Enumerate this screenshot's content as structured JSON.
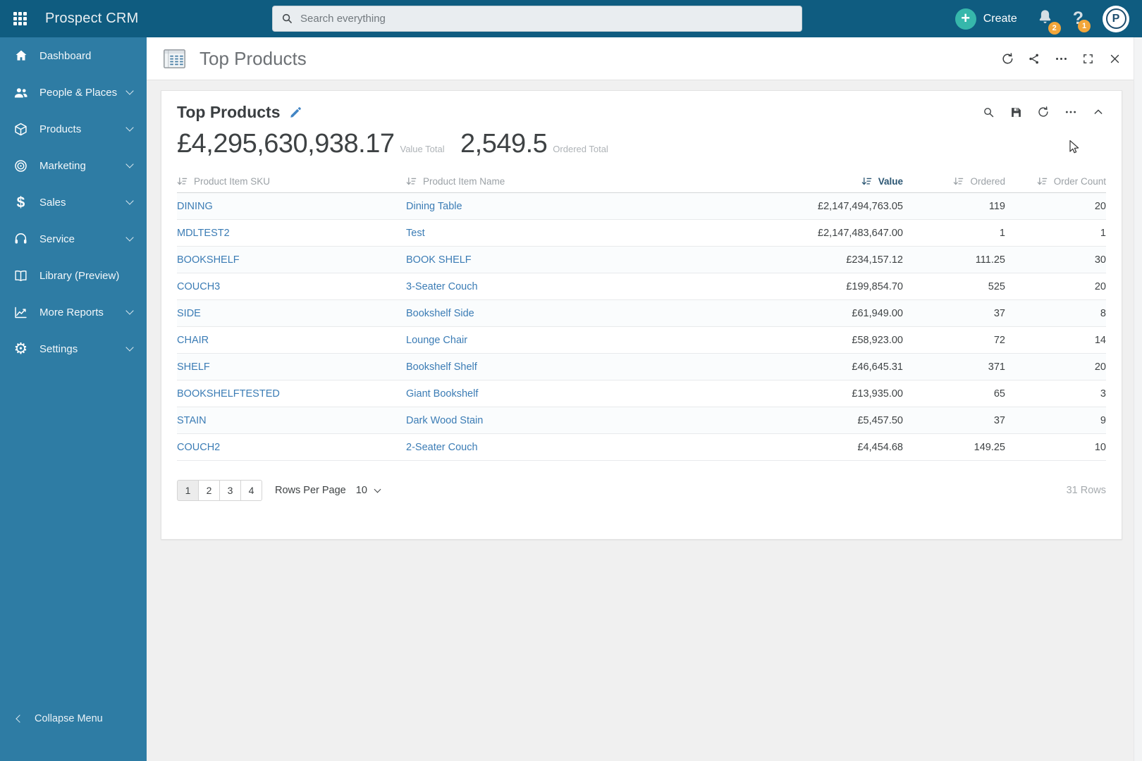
{
  "topbar": {
    "app_name": "Prospect CRM",
    "search": {
      "placeholder": "Search everything"
    },
    "create_label": "Create",
    "notifications_badge": "2",
    "help_badge": "1",
    "avatar_letter": "P"
  },
  "sidebar": {
    "items": [
      {
        "label": "Dashboard",
        "icon": "home",
        "chevron": false
      },
      {
        "label": "People & Places",
        "icon": "people",
        "chevron": true
      },
      {
        "label": "Products",
        "icon": "cube",
        "chevron": true
      },
      {
        "label": "Marketing",
        "icon": "target",
        "chevron": true
      },
      {
        "label": "Sales",
        "icon": "dollar",
        "chevron": true
      },
      {
        "label": "Service",
        "icon": "headset",
        "chevron": true
      },
      {
        "label": "Library (Preview)",
        "icon": "book",
        "chevron": false
      },
      {
        "label": "More Reports",
        "icon": "chart",
        "chevron": true
      },
      {
        "label": "Settings",
        "icon": "gear",
        "chevron": true
      }
    ],
    "collapse_label": "Collapse Menu"
  },
  "page_header": {
    "title": "Top Products"
  },
  "report": {
    "title": "Top Products",
    "totals": [
      {
        "value": "£4,295,630,938.17",
        "label": "Value Total"
      },
      {
        "value": "2,549.5",
        "label": "Ordered Total"
      }
    ],
    "table": {
      "columns": [
        {
          "label": "Product Item SKU",
          "sorted": false
        },
        {
          "label": "Product Item Name",
          "sorted": false
        },
        {
          "label": "Value",
          "sorted": true
        },
        {
          "label": "Ordered",
          "sorted": false
        },
        {
          "label": "Order Count",
          "sorted": false
        }
      ],
      "rows": [
        {
          "sku": "DINING",
          "name": "Dining Table",
          "value": "£2,147,494,763.05",
          "ordered": "119",
          "order_count": "20"
        },
        {
          "sku": "MDLTEST2",
          "name": "Test",
          "value": "£2,147,483,647.00",
          "ordered": "1",
          "order_count": "1"
        },
        {
          "sku": "BOOKSHELF",
          "name": "BOOK SHELF",
          "value": "£234,157.12",
          "ordered": "111.25",
          "order_count": "30"
        },
        {
          "sku": "COUCH3",
          "name": "3-Seater Couch",
          "value": "£199,854.70",
          "ordered": "525",
          "order_count": "20"
        },
        {
          "sku": "SIDE",
          "name": "Bookshelf Side",
          "value": "£61,949.00",
          "ordered": "37",
          "order_count": "8"
        },
        {
          "sku": "CHAIR",
          "name": "Lounge Chair",
          "value": "£58,923.00",
          "ordered": "72",
          "order_count": "14"
        },
        {
          "sku": "SHELF",
          "name": "Bookshelf Shelf",
          "value": "£46,645.31",
          "ordered": "371",
          "order_count": "20"
        },
        {
          "sku": "BOOKSHELFTESTED",
          "name": "Giant Bookshelf",
          "value": "£13,935.00",
          "ordered": "65",
          "order_count": "3"
        },
        {
          "sku": "STAIN",
          "name": "Dark Wood Stain",
          "value": "£5,457.50",
          "ordered": "37",
          "order_count": "9"
        },
        {
          "sku": "COUCH2",
          "name": "2-Seater Couch",
          "value": "£4,454.68",
          "ordered": "149.25",
          "order_count": "10"
        }
      ]
    },
    "pagination": {
      "pages": [
        {
          "label": "1",
          "active": true
        },
        {
          "label": "2",
          "active": false
        },
        {
          "label": "3",
          "active": false
        },
        {
          "label": "4",
          "active": false
        }
      ],
      "rows_per_page_label": "Rows Per Page",
      "rows_per_page_value": "10",
      "total_rows": "31 Rows"
    }
  },
  "colors": {
    "topbar_bg": "#0f5c80",
    "sidebar_bg": "#2e7ca4",
    "accent_teal": "#36b7ab",
    "badge_orange": "#f2a63a",
    "link_blue": "#3b7cb5",
    "sorted_header": "#2a5572"
  }
}
